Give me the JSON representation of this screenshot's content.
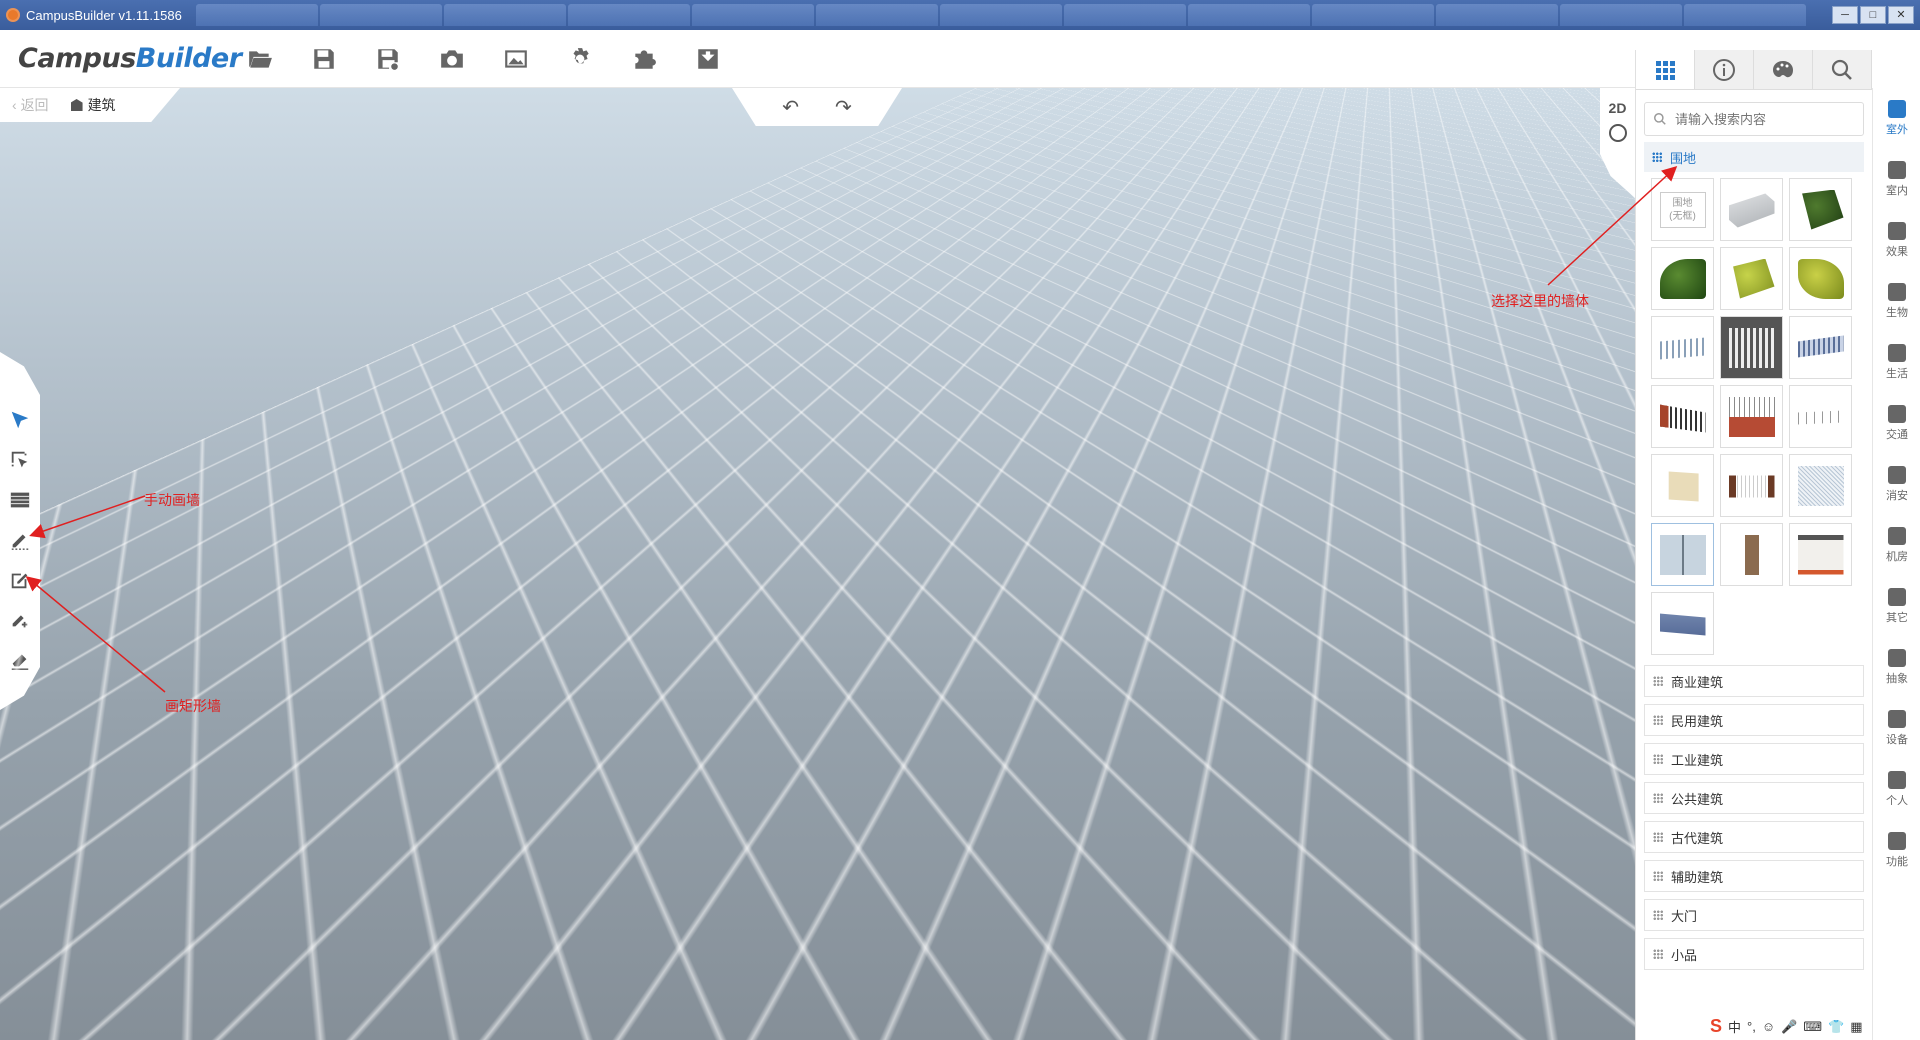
{
  "window": {
    "title": "CampusBuilder v1.11.1586",
    "controls": [
      "─",
      "□",
      "✕"
    ]
  },
  "app": {
    "logo_part1": "Campus",
    "logo_part2": "Builder"
  },
  "toolbar": {
    "icons": [
      "folder-open-icon",
      "save-icon",
      "save-as-icon",
      "camera-icon",
      "image-icon",
      "gear-icon",
      "puzzle-icon",
      "archive-icon"
    ]
  },
  "breadcrumb": {
    "back_label": "返回",
    "current_label": "建筑"
  },
  "view": {
    "mode_label": "2D"
  },
  "annotations": {
    "select_wall": "选择这里的墙体",
    "manual_wall": "手动画墙",
    "rect_wall": "画矩形墙"
  },
  "panel": {
    "search_placeholder": "请输入搜索内容",
    "open_category": "围地",
    "blank_item_line1": "围地",
    "blank_item_line2": "(无框)",
    "categories": [
      "商业建筑",
      "民用建筑",
      "工业建筑",
      "公共建筑",
      "古代建筑",
      "辅助建筑",
      "大门",
      "小品"
    ]
  },
  "sidenav": {
    "items": [
      "室外",
      "室内",
      "效果",
      "生物",
      "生活",
      "交通",
      "消安",
      "机房",
      "其它",
      "抽象",
      "设备",
      "个人",
      "功能"
    ]
  },
  "taskbar": {
    "ime": "中"
  },
  "colors": {
    "accent": "#2a7ac7",
    "annotation": "#e02020"
  }
}
